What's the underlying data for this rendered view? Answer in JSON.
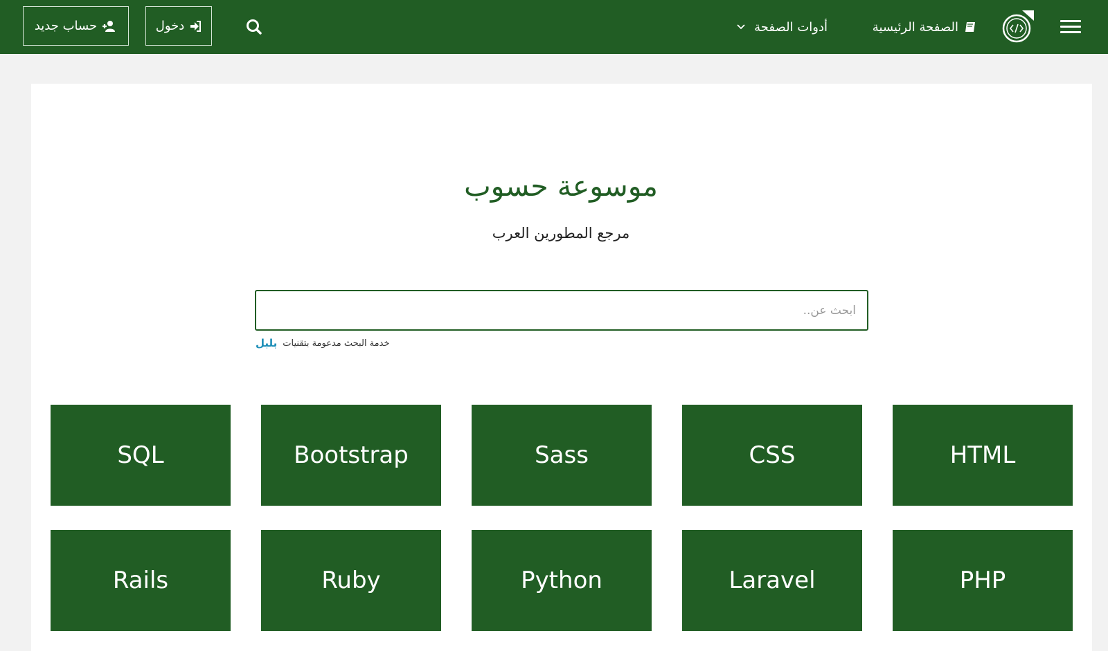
{
  "header": {
    "menu_icon": "hamburger-icon",
    "logo_icon": "code-logo-icon",
    "home_label": "الصفحة الرئيسية",
    "home_icon": "book-icon",
    "tools_label": "أدوات الصفحة",
    "tools_icon": "chevron-down-icon",
    "search_icon": "search-icon",
    "login_label": "دخول",
    "login_icon": "sign-in-icon",
    "register_label": "حساب جديد",
    "register_icon": "user-plus-icon",
    "bar_color": "#215d24"
  },
  "hero": {
    "title": "موسوعة حسوب",
    "subtitle": "مرجع المطورين العرب"
  },
  "search": {
    "placeholder": "ابحث عن..",
    "value": "",
    "powered_text": "خدمة البحث مدعومة بتقنيات",
    "powered_brand": "بلبل"
  },
  "tiles": [
    {
      "label": "HTML"
    },
    {
      "label": "CSS"
    },
    {
      "label": "Sass"
    },
    {
      "label": "Bootstrap"
    },
    {
      "label": "SQL"
    },
    {
      "label": "PHP"
    },
    {
      "label": "Laravel"
    },
    {
      "label": "Python"
    },
    {
      "label": "Ruby"
    },
    {
      "label": "Rails"
    }
  ],
  "tile_color": "#215d24"
}
